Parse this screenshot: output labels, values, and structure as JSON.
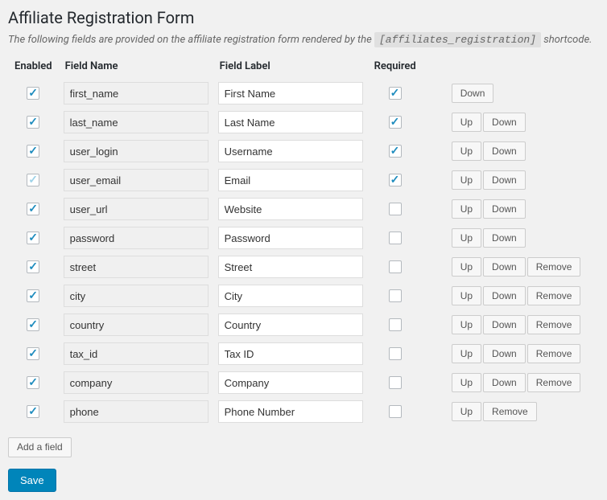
{
  "heading": "Affiliate Registration Form",
  "description_pre": "The following fields are provided on the affiliate registration form rendered by the ",
  "shortcode": "[affiliates_registration]",
  "description_post": " shortcode.",
  "columns": {
    "enabled": "Enabled",
    "field_name": "Field Name",
    "field_label": "Field Label",
    "required": "Required"
  },
  "buttons": {
    "up": "Up",
    "down": "Down",
    "remove": "Remove",
    "add_field": "Add a field",
    "save": "Save"
  },
  "rows": [
    {
      "enabled": true,
      "light": false,
      "name": "first_name",
      "label": "First Name",
      "required": true,
      "show_up": false,
      "show_down": true,
      "show_remove": false
    },
    {
      "enabled": true,
      "light": false,
      "name": "last_name",
      "label": "Last Name",
      "required": true,
      "show_up": true,
      "show_down": true,
      "show_remove": false
    },
    {
      "enabled": true,
      "light": false,
      "name": "user_login",
      "label": "Username",
      "required": true,
      "show_up": true,
      "show_down": true,
      "show_remove": false
    },
    {
      "enabled": true,
      "light": true,
      "name": "user_email",
      "label": "Email",
      "required": true,
      "show_up": true,
      "show_down": true,
      "show_remove": false
    },
    {
      "enabled": true,
      "light": false,
      "name": "user_url",
      "label": "Website",
      "required": false,
      "show_up": true,
      "show_down": true,
      "show_remove": false
    },
    {
      "enabled": true,
      "light": false,
      "name": "password",
      "label": "Password",
      "required": false,
      "show_up": true,
      "show_down": true,
      "show_remove": false
    },
    {
      "enabled": true,
      "light": false,
      "name": "street",
      "label": "Street",
      "required": false,
      "show_up": true,
      "show_down": true,
      "show_remove": true
    },
    {
      "enabled": true,
      "light": false,
      "name": "city",
      "label": "City",
      "required": false,
      "show_up": true,
      "show_down": true,
      "show_remove": true
    },
    {
      "enabled": true,
      "light": false,
      "name": "country",
      "label": "Country",
      "required": false,
      "show_up": true,
      "show_down": true,
      "show_remove": true
    },
    {
      "enabled": true,
      "light": false,
      "name": "tax_id",
      "label": "Tax ID",
      "required": false,
      "show_up": true,
      "show_down": true,
      "show_remove": true
    },
    {
      "enabled": true,
      "light": false,
      "name": "company",
      "label": "Company",
      "required": false,
      "show_up": true,
      "show_down": true,
      "show_remove": true
    },
    {
      "enabled": true,
      "light": false,
      "name": "phone",
      "label": "Phone Number",
      "required": false,
      "show_up": true,
      "show_down": false,
      "show_remove": true
    }
  ]
}
